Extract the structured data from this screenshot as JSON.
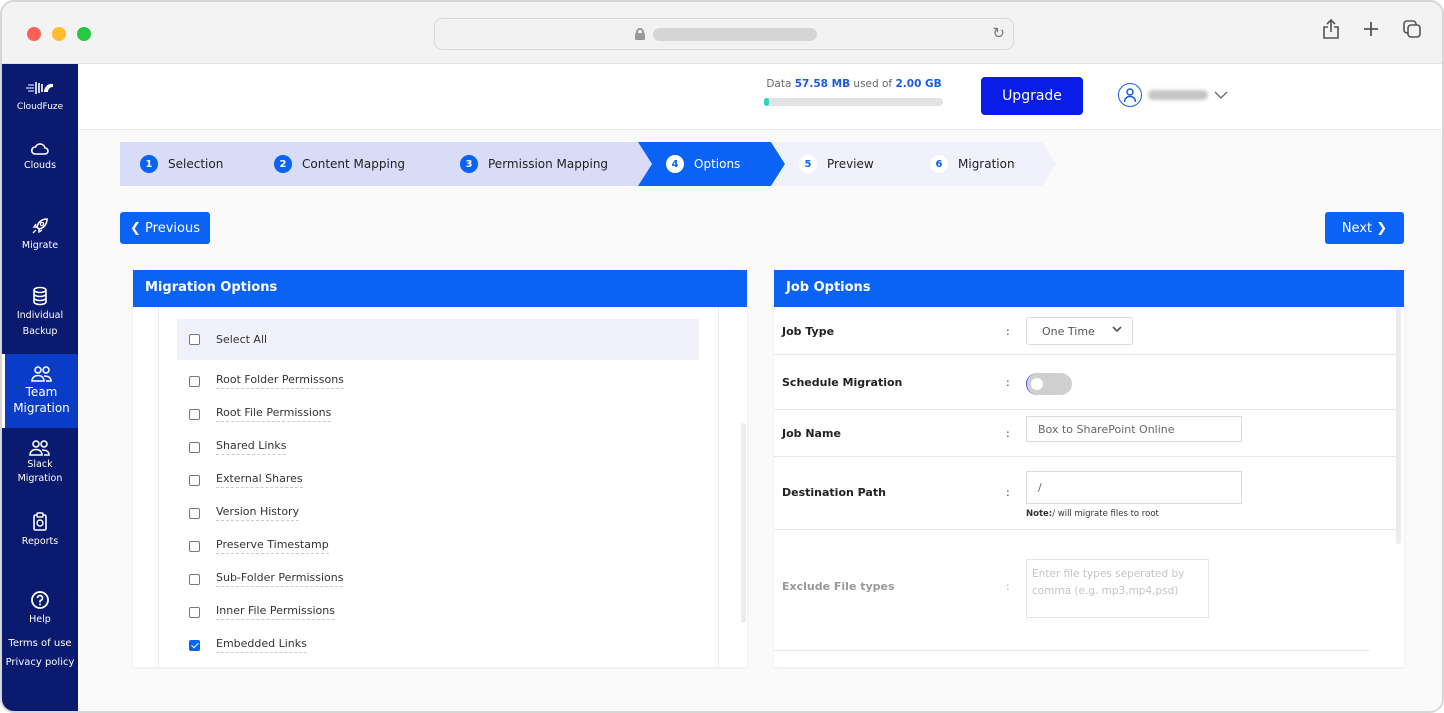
{
  "browser": {
    "url_redacted": true,
    "reload_icon": "reload-icon",
    "toolbar_icons": [
      "share-icon",
      "new-tab-icon",
      "tabs-overview-icon"
    ]
  },
  "sidebar": {
    "brand": "CloudFuze",
    "items": [
      {
        "label": "Clouds",
        "icon": "cloud-icon",
        "active": false
      },
      {
        "label": "Migrate",
        "icon": "rocket-icon",
        "active": false
      },
      {
        "label": "Individual Backup",
        "icon": "database-icon",
        "active": false
      },
      {
        "label": "Team Migration",
        "icon": "team-icon",
        "active": true
      },
      {
        "label": "Slack Migration",
        "icon": "team-icon",
        "active": false
      },
      {
        "label": "Reports",
        "icon": "clipboard-icon",
        "active": false
      },
      {
        "label": "Help",
        "icon": "help-icon",
        "active": false
      }
    ],
    "links": [
      "Terms of use",
      "Privacy policy"
    ]
  },
  "header": {
    "usage_prefix": "Data",
    "usage_used": "57.58 MB",
    "usage_middle": "used of",
    "usage_total": "2.00 GB",
    "usage_fraction": 0.028,
    "upgrade_label": "Upgrade",
    "user_name_redacted": true
  },
  "stepper": {
    "steps": [
      {
        "num": "1",
        "label": "Selection",
        "state": "done"
      },
      {
        "num": "2",
        "label": "Content Mapping",
        "state": "done"
      },
      {
        "num": "3",
        "label": "Permission Mapping",
        "state": "done"
      },
      {
        "num": "4",
        "label": "Options",
        "state": "active"
      },
      {
        "num": "5",
        "label": "Preview",
        "state": "todo"
      },
      {
        "num": "6",
        "label": "Migration",
        "state": "todo"
      }
    ]
  },
  "nav": {
    "previous_label": "Previous",
    "next_label": "Next"
  },
  "migration_options": {
    "title": "Migration Options",
    "select_all_label": "Select All",
    "select_all_checked": false,
    "options": [
      {
        "label": "Root Folder Permissons",
        "checked": false
      },
      {
        "label": "Root File Permissions",
        "checked": false
      },
      {
        "label": "Shared Links",
        "checked": false
      },
      {
        "label": "External Shares",
        "checked": false
      },
      {
        "label": "Version History",
        "checked": false
      },
      {
        "label": "Preserve Timestamp",
        "checked": false
      },
      {
        "label": "Sub-Folder Permissions",
        "checked": false
      },
      {
        "label": "Inner File Permissions",
        "checked": false
      },
      {
        "label": "Embedded Links",
        "checked": true
      }
    ]
  },
  "job_options": {
    "title": "Job Options",
    "colon": ":",
    "job_type_label": "Job Type",
    "job_type_value": "One Time",
    "schedule_label": "Schedule Migration",
    "schedule_on": false,
    "job_name_label": "Job Name",
    "job_name_value": "Box to SharePoint Online",
    "dest_label": "Destination Path",
    "dest_value": "/",
    "note_bold": "Note:",
    "note_text": "/ will migrate files to root",
    "exclude_label": "Exclude File types",
    "exclude_placeholder": "Enter file types seperated by comma (e.g. mp3,mp4,psd)"
  }
}
